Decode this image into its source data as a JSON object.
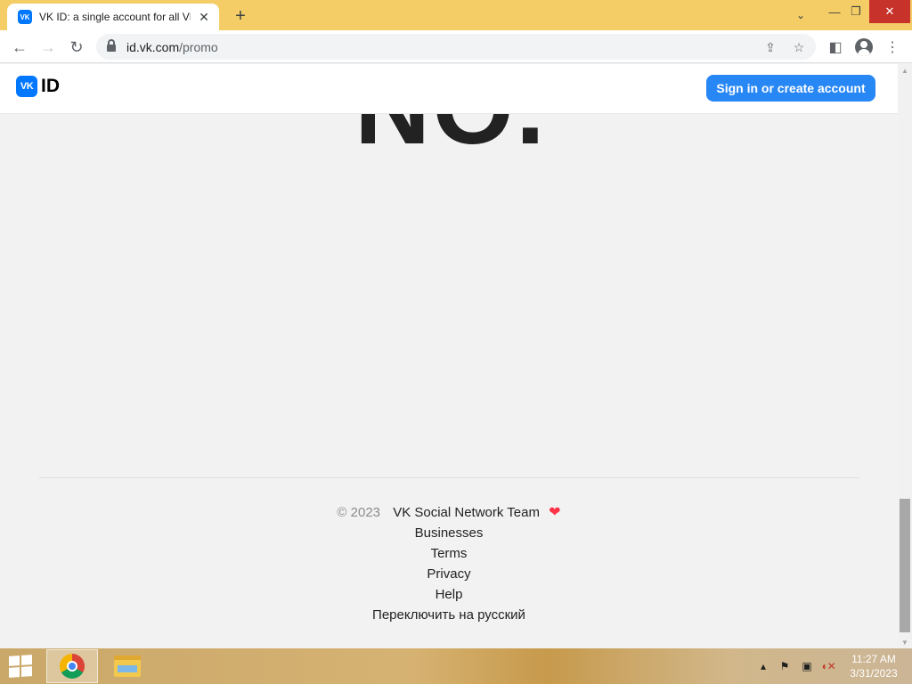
{
  "browser": {
    "tab_title": "VK ID: a single account for all VK",
    "tab_favicon": "VK",
    "url_host": "id.vk.com",
    "url_path": "/promo"
  },
  "site": {
    "logo_mark": "VK",
    "logo_text": "ID",
    "signin_label": "Sign in or create account",
    "hero_partial_text": "NO.",
    "accent_color": "#2787f5"
  },
  "footer": {
    "copyright": "© 2023",
    "team": "VK Social Network Team",
    "links": [
      "Businesses",
      "Terms",
      "Privacy",
      "Help",
      "Переключить на русский"
    ]
  },
  "taskbar": {
    "time": "11:27 AM",
    "date": "3/31/2023"
  }
}
